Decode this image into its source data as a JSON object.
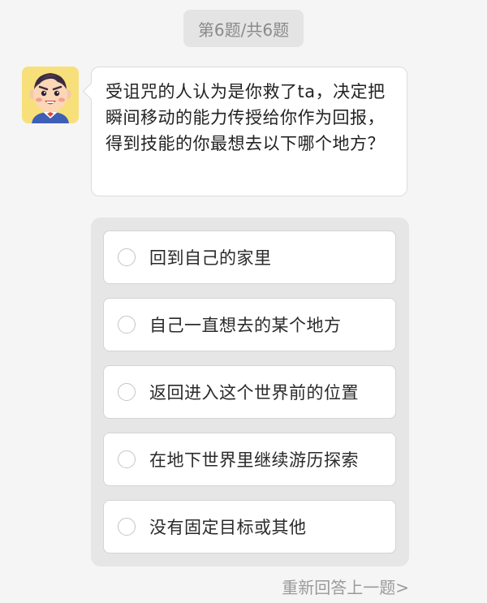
{
  "header": {
    "progress": "第6题/共6题"
  },
  "avatar": {
    "icon": "cartoon-boy-avatar-icon",
    "background": "#f7e07a"
  },
  "question": {
    "text": "受诅咒的人认为是你救了ta，决定把瞬间移动的能力传授给你作为回报，得到技能的你最想去以下哪个地方？"
  },
  "options": [
    {
      "label": "回到自己的家里"
    },
    {
      "label": "自己一直想去的某个地方"
    },
    {
      "label": "返回进入这个世界前的位置"
    },
    {
      "label": "在地下世界里继续游历探索"
    },
    {
      "label": "没有固定目标或其他"
    }
  ],
  "footer": {
    "redo_label": "重新回答上一题>"
  }
}
